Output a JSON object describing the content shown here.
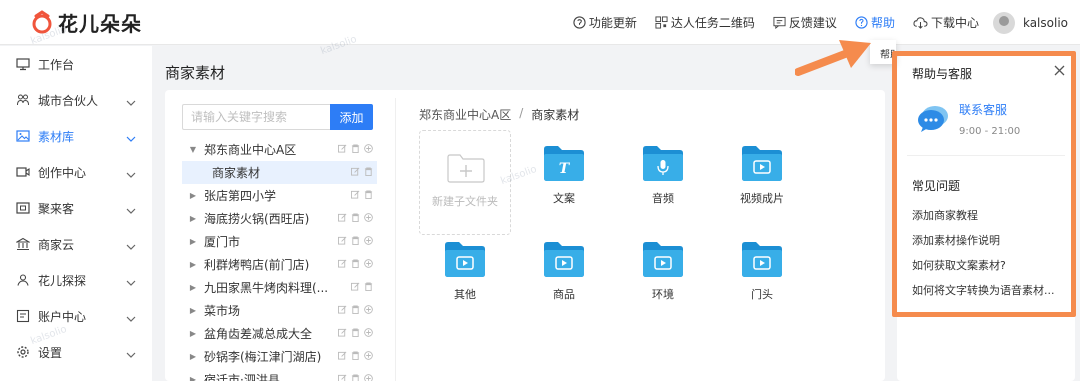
{
  "app": {
    "name": "花儿朵朵"
  },
  "topbar": {
    "actions": [
      {
        "label": "功能更新",
        "icon": "bulb-icon"
      },
      {
        "label": "达人任务二维码",
        "icon": "qrcode-icon"
      },
      {
        "label": "反馈建议",
        "icon": "feedback-icon"
      },
      {
        "label": "帮助",
        "icon": "help-circle-icon",
        "active": true
      },
      {
        "label": "下载中心",
        "icon": "cloud-download-icon"
      }
    ],
    "username": "kalsolio"
  },
  "sidebar": {
    "items": [
      {
        "label": "工作台",
        "icon": "monitor-icon",
        "expandable": false
      },
      {
        "label": "城市合伙人",
        "icon": "partner-icon",
        "expandable": true
      },
      {
        "label": "素材库",
        "icon": "image-icon",
        "expandable": true,
        "active": true
      },
      {
        "label": "创作中心",
        "icon": "video-icon",
        "expandable": true
      },
      {
        "label": "聚来客",
        "icon": "store-icon",
        "expandable": true
      },
      {
        "label": "商家云",
        "icon": "bank-icon",
        "expandable": true
      },
      {
        "label": "花儿探探",
        "icon": "explore-icon",
        "expandable": true
      },
      {
        "label": "账户中心",
        "icon": "account-icon",
        "expandable": true
      },
      {
        "label": "设置",
        "icon": "gear-icon",
        "expandable": true
      }
    ]
  },
  "page": {
    "title": "商家素材"
  },
  "tree": {
    "search_placeholder": "请输入关键字搜索",
    "add_label": "添加",
    "nodes": [
      {
        "label": "郑东商业中心A区",
        "expanded": true,
        "level": 0
      },
      {
        "label": "商家素材",
        "level": 1,
        "selected": true
      },
      {
        "label": "张店第四小学",
        "level": 0
      },
      {
        "label": "海底捞火锅(西旺店)",
        "level": 0
      },
      {
        "label": "厦门市",
        "level": 0
      },
      {
        "label": "利群烤鸭店(前门店)",
        "level": 0
      },
      {
        "label": "九田家黑牛烤肉料理(...",
        "level": 0
      },
      {
        "label": "菜市场",
        "level": 0
      },
      {
        "label": "盆角齿差减总成大全",
        "level": 0
      },
      {
        "label": "砂锅李(梅江津门湖店)",
        "level": 0
      },
      {
        "label": "宿迁市·泗洪县",
        "level": 0
      }
    ]
  },
  "breadcrumb": {
    "root": "郑东商业中心A区",
    "separator": "/",
    "current": "商家素材"
  },
  "folders": {
    "new_label": "新建子文件夹",
    "items": [
      {
        "label": "文案",
        "glyph": "T"
      },
      {
        "label": "音频",
        "glyph": "mic"
      },
      {
        "label": "视频成片",
        "glyph": "play"
      },
      {
        "label": "其他",
        "glyph": "play"
      },
      {
        "label": "商品",
        "glyph": "play"
      },
      {
        "label": "环境",
        "glyph": "play"
      },
      {
        "label": "门头",
        "glyph": "play"
      }
    ]
  },
  "help_panel": {
    "title": "帮助与客服",
    "contact_label": "联系客服",
    "hours": "9:00 - 21:00",
    "faq_title": "常见问题",
    "faq": [
      "添加商家教程",
      "添加素材操作说明",
      "如何获取文案素材?",
      "如何将文字转换为语音素材..."
    ]
  },
  "tooltip": {
    "text": "帮助"
  },
  "colors": {
    "primary": "#2d7df6",
    "highlight": "#f58b4d",
    "folder": "#29a3e0",
    "logo": "#f0553c"
  }
}
